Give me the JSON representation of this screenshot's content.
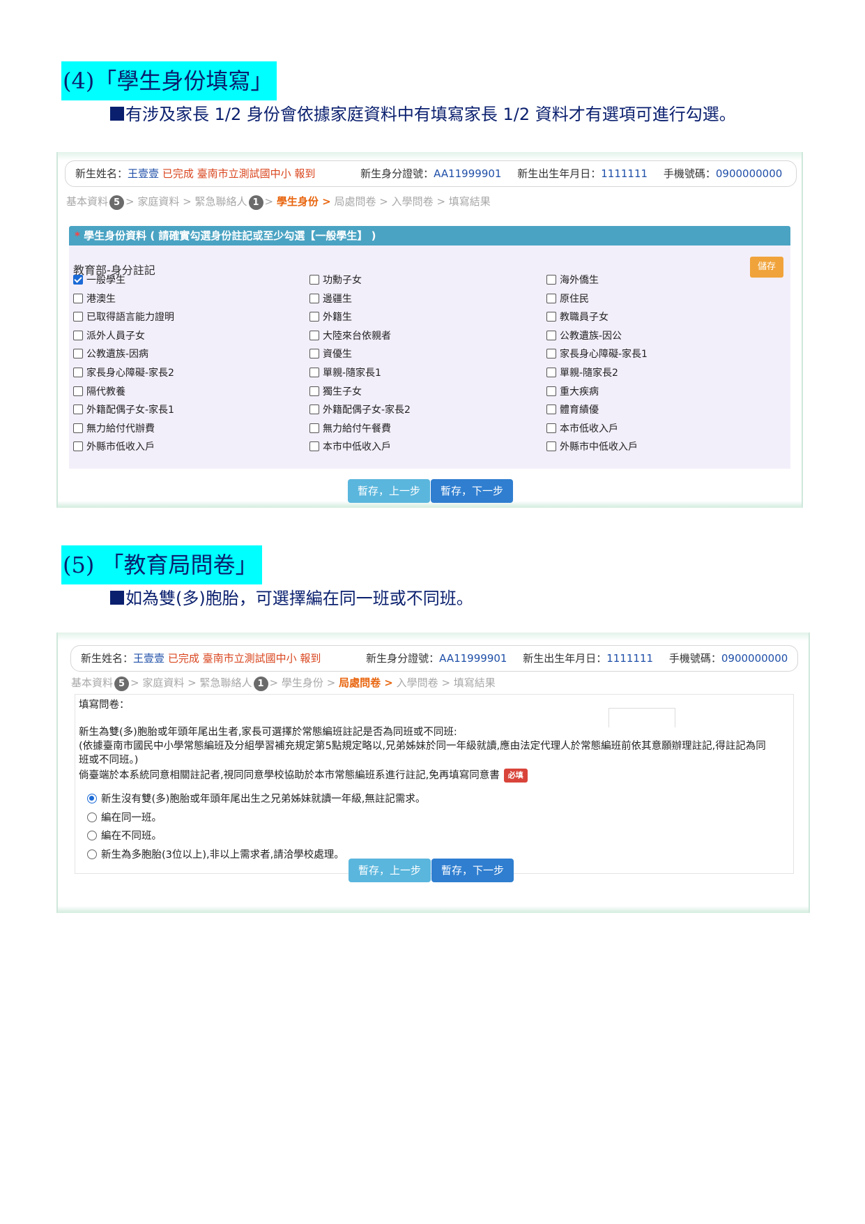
{
  "section4": {
    "title": "(4)「學生身份填寫」",
    "note": "有涉及家長 1/2 身份會依據家庭資料中有填寫家長 1/2 資料才有選項可進行勾選。",
    "info": {
      "name_label": "新生姓名：",
      "name": "王壹壹",
      "status": "已完成 臺南市立測試國中小 報到",
      "id_label": "新生身分證號：",
      "id": "AA11999901",
      "birth_label": "新生出生年月日：",
      "birth": "1111111",
      "phone_label": "手機號碼：",
      "phone": "0900000000"
    },
    "steps": {
      "s1": "基本資料",
      "b1": "5",
      "s2": "家庭資料",
      "s3": "緊急聯絡人",
      "b2": "1",
      "s4": "學生身份 >",
      "s5": "局處問卷",
      "s6": "入學問卷",
      "s7": "填寫結果",
      "sep": ">"
    },
    "panel_title": "學生身份資料 ( 請確實勾選身份註記或至少勾選【一般學生】 )",
    "panel_star": "*",
    "sub_title": "教育部-身分註記",
    "save_label": "儲存",
    "options": [
      [
        "一般學生",
        "功勳子女",
        "海外僑生"
      ],
      [
        "港澳生",
        "邊疆生",
        "原住民"
      ],
      [
        "已取得語言能力證明",
        "外籍生",
        "教職員子女"
      ],
      [
        "派外人員子女",
        "大陸來台依親者",
        "公教遺族-因公"
      ],
      [
        "公教遺族-因病",
        "資優生",
        "家長身心障礙-家長1"
      ],
      [
        "家長身心障礙-家長2",
        "單親-隨家長1",
        "單親-隨家長2"
      ],
      [
        "隔代教養",
        "獨生子女",
        "重大疾病"
      ],
      [
        "外籍配偶子女-家長1",
        "外籍配偶子女-家長2",
        "體育績優"
      ],
      [
        "無力給付代辦費",
        "無力給付午餐費",
        "本市低收入戶"
      ],
      [
        "外縣市低收入戶",
        "本市中低收入戶",
        "外縣市中低收入戶"
      ]
    ],
    "prev_label": "暫存，上一步",
    "next_label": "暫存，下一步"
  },
  "section5": {
    "title": "(5) 「教育局問卷」",
    "note": "如為雙(多)胞胎，可選擇編在同一班或不同班。",
    "info": {
      "name_label": "新生姓名：",
      "name": "王壹壹",
      "status": "已完成 臺南市立測試國中小 報到",
      "id_label": "新生身分證號：",
      "id": "AA11999901",
      "birth_label": "新生出生年月日：",
      "birth": "1111111",
      "phone_label": "手機號碼：",
      "phone": "0900000000"
    },
    "steps": {
      "s1": "基本資料",
      "b1": "5",
      "s2": "家庭資料",
      "s3": "緊急聯絡人",
      "b2": "1",
      "s4": "學生身份",
      "s5": "局處問卷 >",
      "s6": "入學問卷",
      "s7": "填寫結果",
      "sep": ">"
    },
    "q_heading": "填寫問卷：",
    "q_line1": "新生為雙(多)胞胎或年頭年尾出生者,家長可選擇於常態編班註記是否為同班或不同班:",
    "q_line2": "(依據臺南市國民中小學常態編班及分組學習補充規定第5點規定略以,兄弟姊妹於同一年級就讀,應由法定代理人於常態編班前依其意願辦理註記,得註記為同",
    "q_line3": "班或不同班。)",
    "q_line4": "倘臺端於本系統同意相關註記者,視同同意學校協助於本市常態編班系進行註記,免再填寫同意書",
    "required_label": "必填",
    "radios": [
      "新生沒有雙(多)胞胎或年頭年尾出生之兄弟姊妹就讀一年級,無註記需求。",
      "編在同一班。",
      "編在不同班。",
      "新生為多胞胎(3位以上),非以上需求者,請洽學校處理。"
    ],
    "prev_label": "暫存，上一步",
    "next_label": "暫存，下一步"
  }
}
